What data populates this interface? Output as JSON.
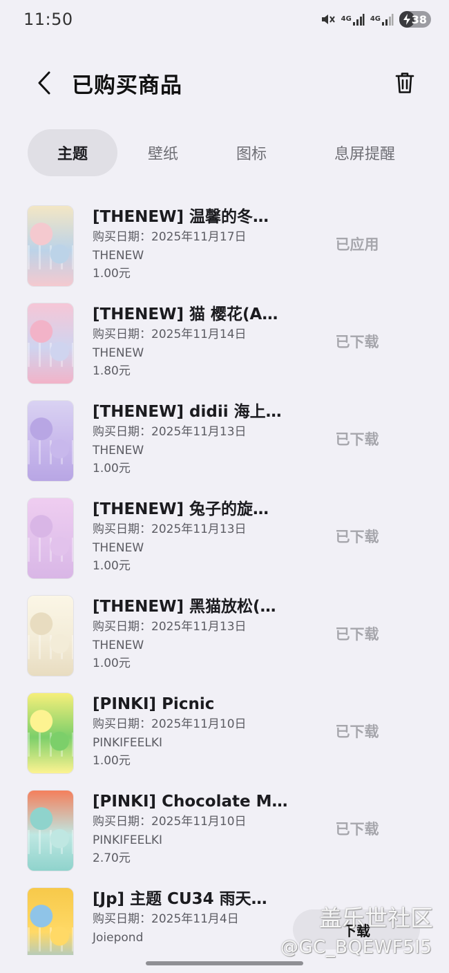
{
  "status_bar": {
    "time": "11:50",
    "net1": "4G",
    "net2": "4G",
    "battery": "38",
    "icons": [
      "mute-icon",
      "signal-icon",
      "signal-icon",
      "battery-charging-icon"
    ]
  },
  "header": {
    "title": "已购买商品",
    "back_icon": "chevron-left-icon",
    "trash_icon": "trash-icon"
  },
  "tabs": [
    {
      "label": "主题",
      "active": true
    },
    {
      "label": "壁纸",
      "active": false
    },
    {
      "label": "图标",
      "active": false
    },
    {
      "label": "息屏提醒",
      "active": false
    }
  ],
  "items": [
    {
      "title": "[THENEW] 温馨的冬…",
      "date": "购买日期：2025年11月17日",
      "author": "THENEW",
      "price": "1.00元",
      "status": "已应用",
      "colors": [
        "#f3e6c4",
        "#bcd3e8",
        "#f4c9cf"
      ]
    },
    {
      "title": "[THENEW] 猫 樱花(A…",
      "date": "购买日期：2025年11月14日",
      "author": "THENEW",
      "price": "1.80元",
      "status": "已下载",
      "colors": [
        "#f6c6d6",
        "#cfd4ef",
        "#f2b3c8"
      ]
    },
    {
      "title": "[THENEW] didii 海上…",
      "date": "购买日期：2025年11月13日",
      "author": "THENEW",
      "price": "1.00元",
      "status": "已下载",
      "colors": [
        "#d9d2f2",
        "#c8b8ec",
        "#b8a6e4"
      ]
    },
    {
      "title": "[THENEW] 兔子的旋…",
      "date": "购买日期：2025年11月13日",
      "author": "THENEW",
      "price": "1.00元",
      "status": "已下载",
      "colors": [
        "#efcdf0",
        "#e2c2ec",
        "#d9b6e6"
      ]
    },
    {
      "title": "[THENEW] 黑猫放松(…",
      "date": "购买日期：2025年11月13日",
      "author": "THENEW",
      "price": "1.00元",
      "status": "已下载",
      "colors": [
        "#fbf6e6",
        "#f3ecd8",
        "#e8dcc0"
      ]
    },
    {
      "title": "[PINKI] Picnic",
      "date": "购买日期：2025年11月10日",
      "author": "PINKIFEELKI",
      "price": "1.00元",
      "status": "已下载",
      "colors": [
        "#f6ef7a",
        "#7ccf6a",
        "#fdf391"
      ]
    },
    {
      "title": "[PINKI] Chocolate M…",
      "date": "购买日期：2025年11月10日",
      "author": "PINKIFEELKI",
      "price": "2.70元",
      "status": "已下载",
      "colors": [
        "#f47f5c",
        "#bfe7e2",
        "#8fd3cc"
      ]
    },
    {
      "title": "[Jp] 主题 CU34 雨天…",
      "date": "购买日期：2025年11月4日",
      "author": "Joiepond",
      "price": "",
      "status": "",
      "colors": [
        "#f7c94a",
        "#ffd966",
        "#8fc4e8"
      ]
    }
  ],
  "download_button": "下载",
  "watermark": {
    "line1": "盖乐世社区",
    "line2": "@GC_BQEWF5I5"
  }
}
